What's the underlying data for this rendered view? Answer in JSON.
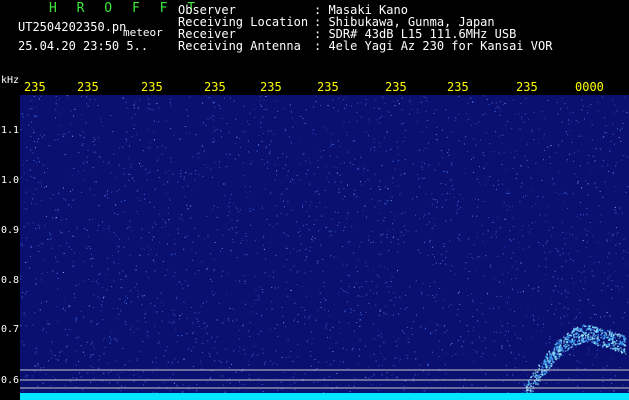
{
  "header": {
    "logo": "H R O F F T",
    "filename": "UT2504202350.pn",
    "tag": "meteor",
    "datetime": "25.04.20 23:50   5..",
    "observer_label": "Observer",
    "observer_value": ": Masaki Kano",
    "location_label": "Receiving Location",
    "location_value": ": Shibukawa, Gunma, Japan",
    "receiver_label": "Receiver",
    "receiver_value": ": SDR# 43dB L15 111.6MHz USB",
    "antenna_label": "Receiving Antenna",
    "antenna_value": ": 4ele Yagi Az 230 for Kansai VOR"
  },
  "axis": {
    "unit": "kHz",
    "labels": [
      "1.1",
      "1.0",
      "0.9",
      "0.8",
      "0.7",
      "0.6"
    ]
  },
  "time_ticks": [
    "235",
    "235",
    "235",
    "235",
    "235",
    "235",
    "235",
    "235",
    "235",
    "0000"
  ],
  "colors": {
    "background": "#0a1070",
    "speckle": "#4a7cff",
    "baseline": "#00e5ff",
    "meteor_trail": "#9ff0ff",
    "tick_text": "#ffff00",
    "logo": "#3ee63e"
  }
}
